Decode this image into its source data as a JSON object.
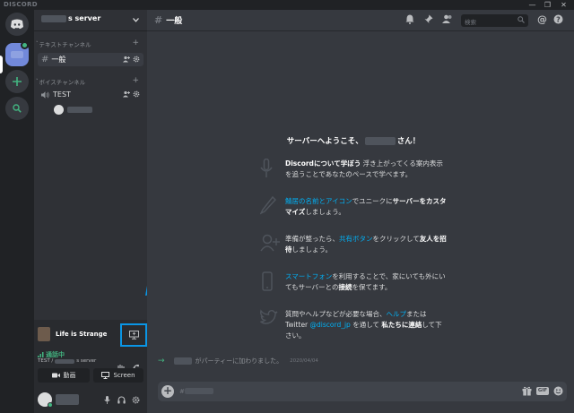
{
  "app": {
    "brand": "DISCORD",
    "window_controls": [
      "—",
      "❐",
      "✕"
    ]
  },
  "server": {
    "name": "s server"
  },
  "categories": {
    "text": "テキストチャンネル",
    "voice": "ボイスチャンネル"
  },
  "channels": {
    "text_channel": "一般",
    "voice_channel": "TEST"
  },
  "activity": {
    "game": "Life is Strange"
  },
  "voice": {
    "status": "通話中",
    "sub_prefix": "TEST /",
    "sub_suffix": "s server",
    "video_label": "動画",
    "screen_label": "Screen"
  },
  "main": {
    "channel_title": "一般",
    "search_placeholder": "検索",
    "welcome_prefix": "サーバーへようこそ、",
    "welcome_suffix": "さん！",
    "tips": [
      {
        "plain_a": "Discord",
        "bold_a": "について学ぼう",
        "plain_b": " 浮き上がってくる案内表示を追うことであなたのペースで学べます。"
      },
      {
        "link_a": "鯖居の名前とアイコン",
        "plain_a": "でユニークに",
        "bold_a": "サーバーをカスタマイズ",
        "plain_b": "しましょう。"
      },
      {
        "plain_a": "準備が整ったら、",
        "link_a": "共有ボタン",
        "plain_b": "をクリックして",
        "bold_a": "友人を招待",
        "plain_c": "しましょう。"
      },
      {
        "link_a": "スマートフォン",
        "plain_a": "を利用することで、家にいても外にいてもサーバーとの",
        "bold_a": "接続",
        "plain_b": "を保てます。"
      },
      {
        "plain_a": "質問やヘルプなどが必要な場合、",
        "link_a": "ヘルプ",
        "plain_b": "または Twitter ",
        "link_b": "@discord_jp",
        "plain_c": " を通して ",
        "bold_a": "私たちに連絡",
        "plain_d": "して下さい。"
      }
    ],
    "system_message": "がパーティーに加わりました。",
    "system_date": "2020/04/04",
    "composer_placeholder": "#"
  },
  "colors": {
    "accent": "#7289da",
    "online": "#43b581",
    "link": "#00b0f4",
    "callout": "#0a96e6"
  }
}
